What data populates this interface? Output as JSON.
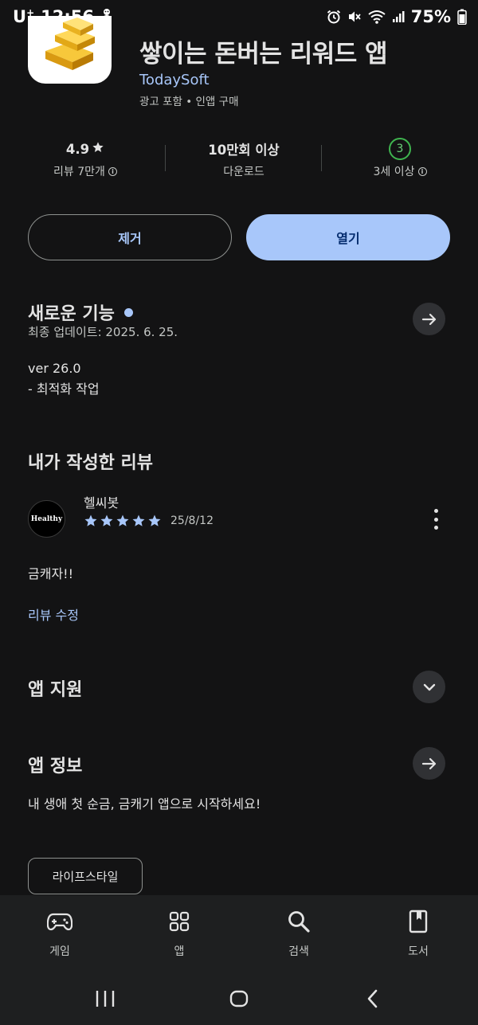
{
  "status_bar": {
    "carrier": "U",
    "carrier_sup": "+",
    "time": "12:56",
    "battery": "75%"
  },
  "app": {
    "title": "쌓이는 돈버는 리워드 앱",
    "developer": "TodaySoft",
    "meta": "광고 포함  •  인앱 구매"
  },
  "stats": {
    "rating_value": "4.9",
    "rating_label": "리뷰 7만개",
    "downloads_value": "10만회 이상",
    "downloads_label": "다운로드",
    "age_value": "3",
    "age_label": "3세 이상"
  },
  "buttons": {
    "uninstall": "제거",
    "open": "열기"
  },
  "whats_new": {
    "title": "새로운 기능",
    "updated": "최종 업데이트: 2025. 6. 25.",
    "line1": "ver 26.0",
    "line2": "- 최적화 작업"
  },
  "my_review": {
    "title": "내가 작성한 리뷰",
    "reviewer": "헬씨봇",
    "avatar_text": "Healthy",
    "rating": 5,
    "date": "25/8/12",
    "text": "금캐자!!",
    "edit_link": "리뷰 수정"
  },
  "app_support": {
    "title": "앱 지원"
  },
  "about": {
    "title": "앱 정보",
    "description": "내 생애 첫 순금, 금캐기 앱으로 시작하세요!",
    "chip": "라이프스타일"
  },
  "bottom_nav": {
    "games": "게임",
    "apps": "앱",
    "search": "검색",
    "books": "도서"
  },
  "colors": {
    "background": "#131314",
    "accent": "#a8c7fa",
    "age_green": "#3fb44f"
  }
}
